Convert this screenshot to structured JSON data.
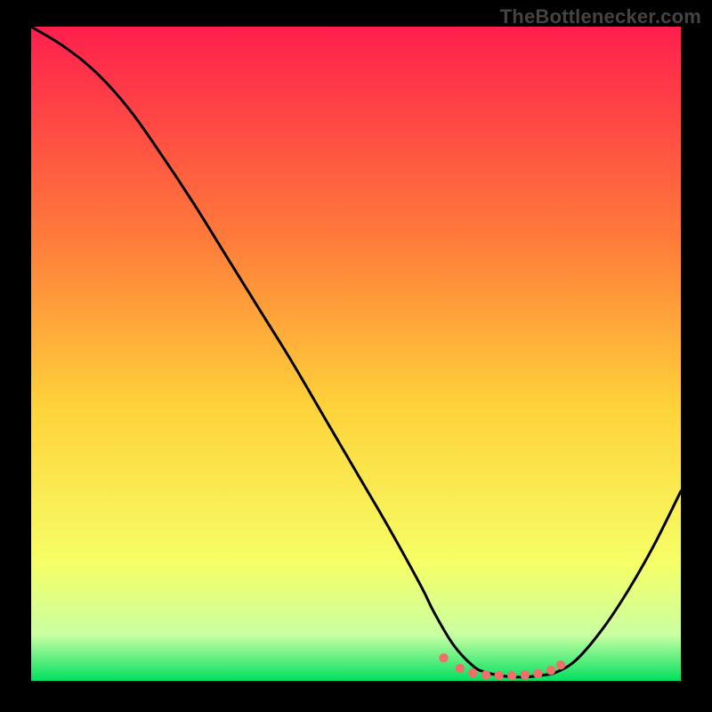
{
  "watermark": "TheBottlenecker.com",
  "colors": {
    "background": "#000000",
    "gradient_top": "#ff1f4d",
    "gradient_mid_upper": "#ff7a3a",
    "gradient_mid": "#ffd23a",
    "gradient_lower": "#f6ff66",
    "gradient_bottom_fade": "#c9ffa3",
    "gradient_bottom": "#00e060",
    "curve": "#000000",
    "dots": "#ef6f6a"
  },
  "chart_data": {
    "type": "line",
    "title": "",
    "xlabel": "",
    "ylabel": "",
    "xlim": [
      0,
      100
    ],
    "ylim": [
      0,
      100
    ],
    "grid": false,
    "legend": false,
    "series": [
      {
        "name": "bottleneck-curve",
        "x": [
          0,
          5,
          10,
          15,
          20,
          25,
          30,
          35,
          40,
          45,
          50,
          55,
          60,
          62,
          65,
          68,
          70,
          73,
          76,
          79,
          81,
          84,
          88,
          92,
          96,
          100
        ],
        "y": [
          100,
          97,
          93,
          87.5,
          80.5,
          73,
          65,
          57,
          49,
          40.5,
          32,
          23.5,
          14.5,
          10.5,
          5.5,
          2.3,
          1.3,
          0.7,
          0.6,
          0.9,
          1.4,
          3.3,
          8,
          14,
          21,
          29
        ]
      }
    ],
    "markers": {
      "name": "highlight-dots",
      "x": [
        63.5,
        66,
        68,
        70,
        72,
        74,
        76,
        78,
        80,
        81.5
      ],
      "y": [
        3.5,
        1.9,
        1.2,
        0.9,
        0.8,
        0.8,
        0.9,
        1.1,
        1.6,
        2.4
      ]
    }
  }
}
